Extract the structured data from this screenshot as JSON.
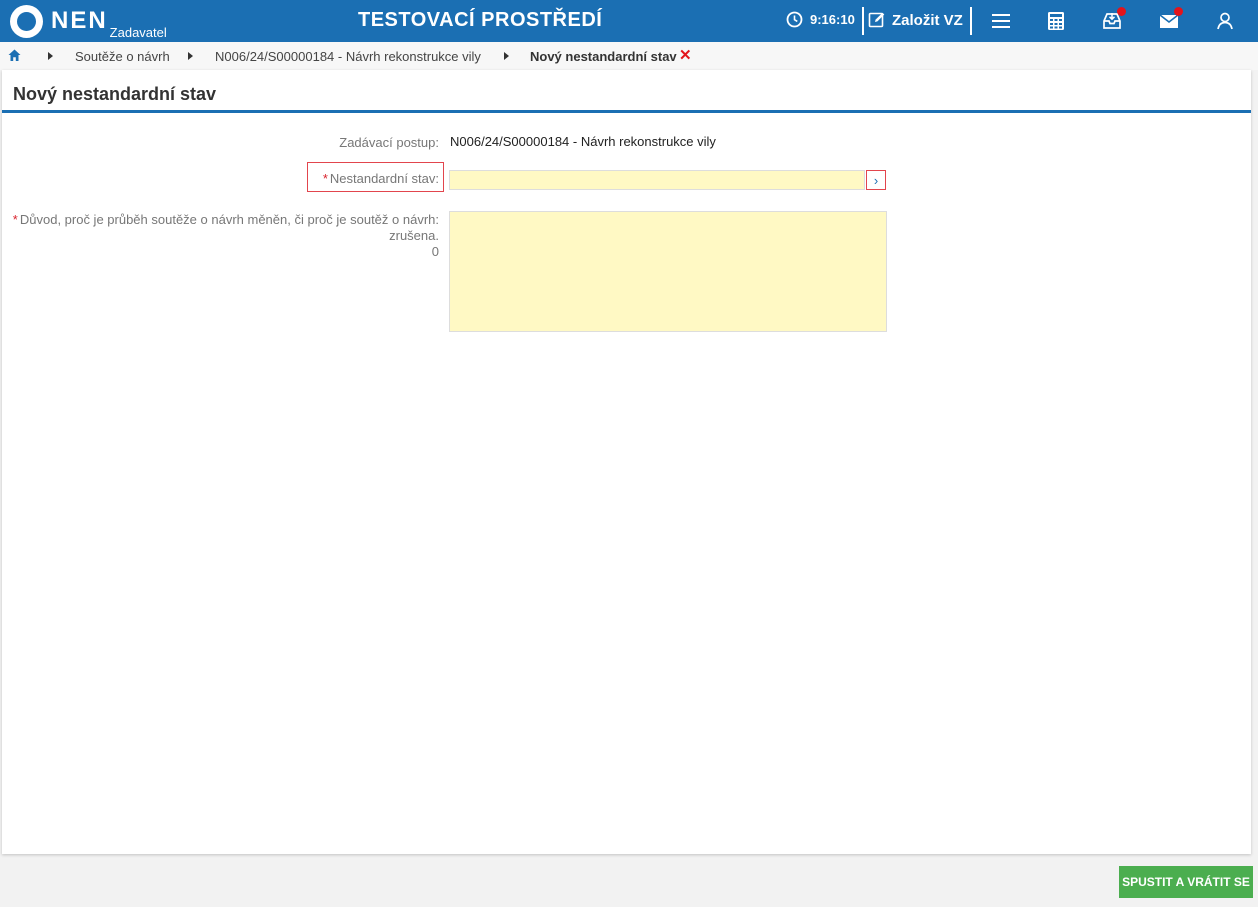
{
  "header": {
    "logo_text": "NEN",
    "logo_sub": "Zadavatel",
    "environment": "TESTOVACÍ PROSTŘEDÍ",
    "time": "9:16:10",
    "new_vz_label": "Založit VZ",
    "accent_color": "#1b6fb3",
    "badge_color": "#e3141b"
  },
  "breadcrumb": {
    "items": [
      "Soutěže o návrh",
      "N006/24/S00000184 - Návrh rekonstrukce vily"
    ],
    "current": "Nový nestandardní stav",
    "close_icon": "✕"
  },
  "page": {
    "title": "Nový nestandardní stav"
  },
  "form": {
    "procedure_label": "Zadávací postup:",
    "procedure_value": "N006/24/S00000184 - Návrh rekonstrukce vily",
    "required_marker": "*",
    "state_label": "Nestandardní stav:",
    "state_value": "",
    "picker_symbol": "›",
    "reason_label_line1": "Důvod, proč je průběh soutěže o návrh měněn, či proč je soutěž o návrh:",
    "reason_label_line2": "zrušena.",
    "reason_count": "0",
    "reason_value": ""
  },
  "footer": {
    "run_button": "SPUSTIT A VRÁTIT SE",
    "run_button_color": "#4bae4f"
  }
}
